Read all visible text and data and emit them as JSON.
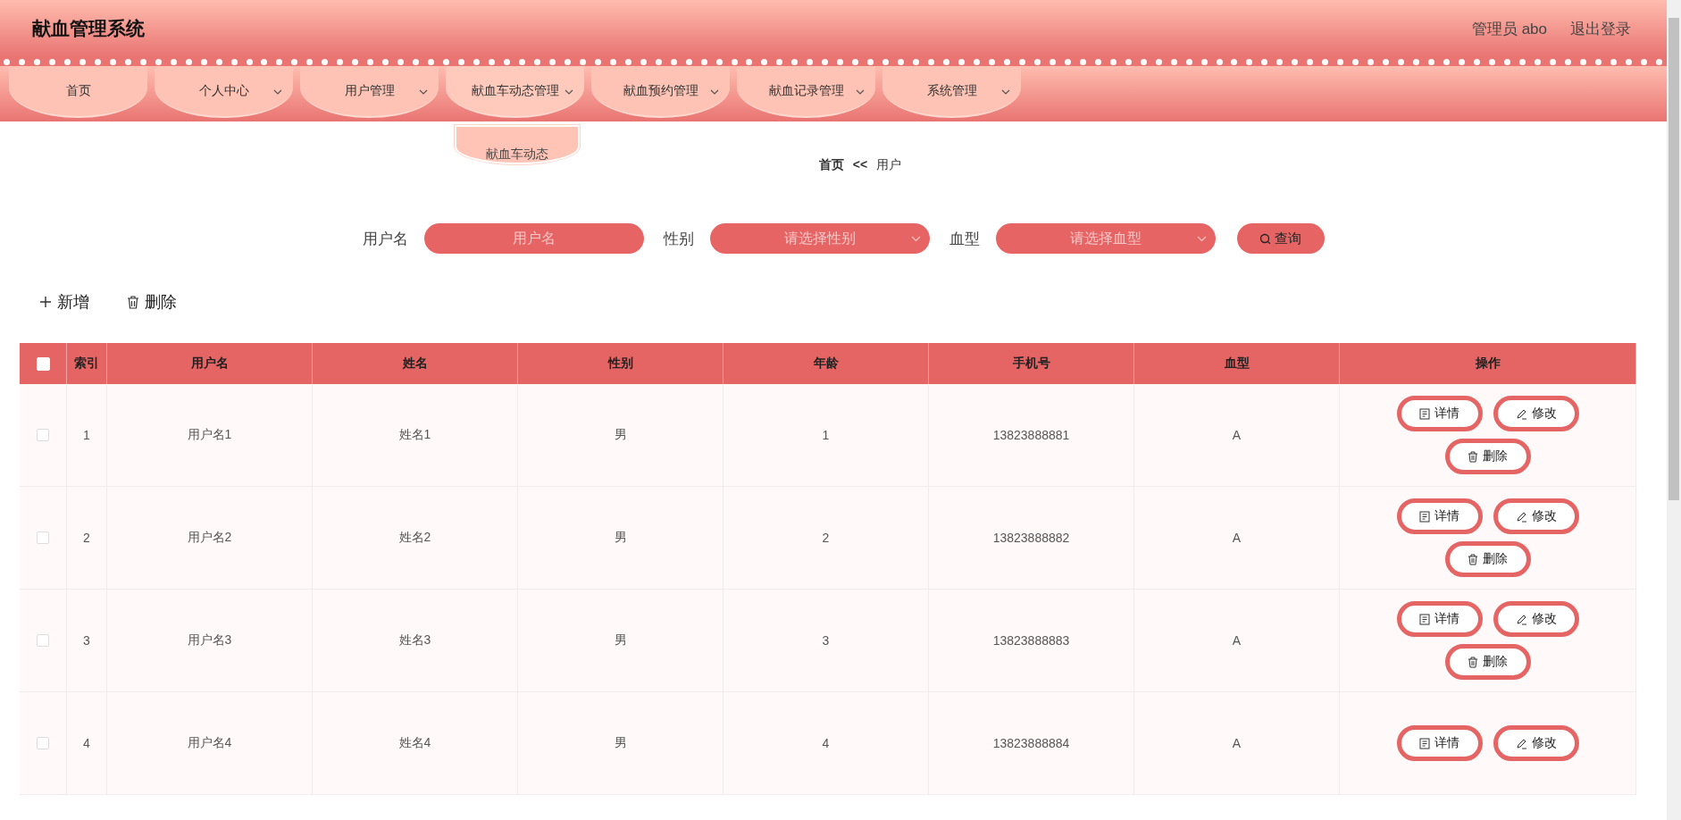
{
  "header": {
    "title": "献血管理系统",
    "user": "管理员 abo",
    "logout": "退出登录"
  },
  "nav": [
    {
      "label": "首页",
      "dropdown": false
    },
    {
      "label": "个人中心",
      "dropdown": true
    },
    {
      "label": "用户管理",
      "dropdown": true
    },
    {
      "label": "献血车动态管理",
      "dropdown": true,
      "submenu": [
        "献血车动态"
      ]
    },
    {
      "label": "献血预约管理",
      "dropdown": true
    },
    {
      "label": "献血记录管理",
      "dropdown": true
    },
    {
      "label": "系统管理",
      "dropdown": true
    }
  ],
  "breadcrumb": {
    "home": "首页",
    "separator": "<<",
    "current": "用户"
  },
  "search": {
    "fields": [
      {
        "label": "用户名",
        "placeholder": "用户名",
        "kind": "text"
      },
      {
        "label": "性别",
        "placeholder": "请选择性别",
        "kind": "select"
      },
      {
        "label": "血型",
        "placeholder": "请选择血型",
        "kind": "select"
      }
    ],
    "button": "查询"
  },
  "toolbar": {
    "add": "新增",
    "delete": "删除"
  },
  "table": {
    "header_checked": false,
    "columns": [
      "索引",
      "用户名",
      "姓名",
      "性别",
      "年龄",
      "手机号",
      "血型",
      "操作"
    ],
    "rows": [
      {
        "checked": false,
        "cells": [
          "1",
          "用户名1",
          "姓名1",
          "男",
          "1",
          "13823888881",
          "A"
        ],
        "actions": [
          {
            "kind": "detail",
            "label": "详情"
          },
          {
            "kind": "edit",
            "label": "修改"
          },
          {
            "kind": "delete",
            "label": "删除"
          }
        ]
      },
      {
        "checked": false,
        "cells": [
          "2",
          "用户名2",
          "姓名2",
          "男",
          "2",
          "13823888882",
          "A"
        ],
        "actions": [
          {
            "kind": "detail",
            "label": "详情"
          },
          {
            "kind": "edit",
            "label": "修改"
          },
          {
            "kind": "delete",
            "label": "删除"
          }
        ]
      },
      {
        "checked": false,
        "cells": [
          "3",
          "用户名3",
          "姓名3",
          "男",
          "3",
          "13823888883",
          "A"
        ],
        "actions": [
          {
            "kind": "detail",
            "label": "详情"
          },
          {
            "kind": "edit",
            "label": "修改"
          },
          {
            "kind": "delete",
            "label": "删除"
          }
        ]
      },
      {
        "checked": false,
        "cells": [
          "4",
          "用户名4",
          "姓名4",
          "男",
          "4",
          "13823888884",
          "A"
        ],
        "actions": [
          {
            "kind": "detail",
            "label": "详情"
          },
          {
            "kind": "edit",
            "label": "修改"
          }
        ]
      }
    ]
  }
}
